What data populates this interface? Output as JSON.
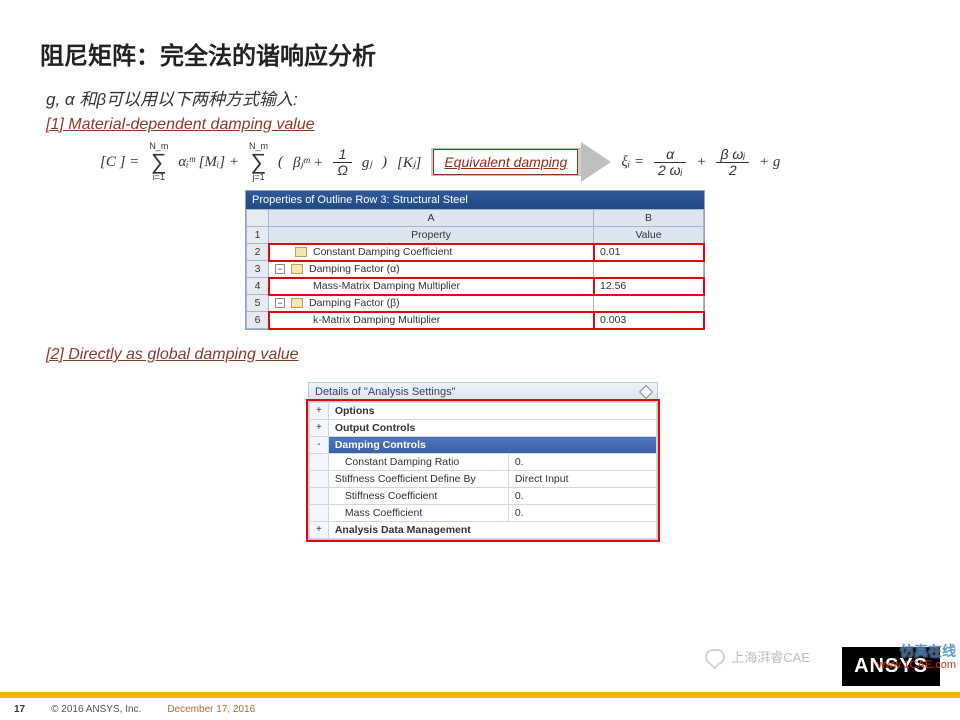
{
  "title": "阻尼矩阵：完全法的谐响应分析",
  "subtitle": "g, α 和β可以用以下两种方式输入:",
  "section1_label": "[1] Material-dependent damping value",
  "section2_label": "[2] Directly as global damping value",
  "equiv_label": "Equivalent damping",
  "formula": {
    "lhs": "[C ] =",
    "sum1_top": "N_m",
    "sum1_bot": "i=1",
    "term1": "αᵢᵐ [Mᵢ] +",
    "sum2_top": "N_m",
    "sum2_bot": "j=1",
    "paren_beta": "βⱼᵐ +",
    "frac_one": "1",
    "frac_omega": "Ω",
    "g_j": "gⱼ",
    "k_j": "[Kⱼ]",
    "xi": "ξᵢ =",
    "f1n": "α",
    "f1d": "2 ωᵢ",
    "f2n": "β ωᵢ",
    "f2d": "2",
    "plus_g": "+ g"
  },
  "tbl1": {
    "title": "Properties of Outline Row 3: Structural Steel",
    "col_a": "A",
    "col_b": "B",
    "head_a": "Property",
    "head_b": "Value",
    "rows": [
      {
        "n": "2",
        "name": "Constant Damping Coefficient",
        "value": "0.01",
        "icon": "chart"
      },
      {
        "n": "3",
        "name": "Damping Factor (α)",
        "value": "",
        "icon": "toggle"
      },
      {
        "n": "4",
        "name": "Mass-Matrix Damping Multiplier",
        "value": "12.56"
      },
      {
        "n": "5",
        "name": "Damping Factor (β)",
        "value": "",
        "icon": "toggle"
      },
      {
        "n": "6",
        "name": "k-Matrix Damping Multiplier",
        "value": "0.003"
      }
    ]
  },
  "details": {
    "title": "Details of \"Analysis Settings\"",
    "rows": [
      {
        "t": "+",
        "label": "Options"
      },
      {
        "t": "+",
        "label": "Output Controls"
      },
      {
        "t": "-",
        "label": "Damping Controls",
        "section": true
      },
      {
        "label": "Constant Damping Ratio",
        "value": "0."
      },
      {
        "label": "Stiffness Coefficient Define By",
        "value": "Direct Input"
      },
      {
        "label": "Stiffness Coefficient",
        "value": "0."
      },
      {
        "label": "Mass Coefficient",
        "value": "0."
      },
      {
        "t": "+",
        "label": "Analysis Data Management"
      }
    ]
  },
  "footer": {
    "page": "17",
    "copyright": "© 2016 ANSYS, Inc.",
    "date": "December 17, 2016"
  },
  "watermark": {
    "chat": "上海湃睿CAE",
    "zh": "仿真在线",
    "url": "www.1CAE.com"
  },
  "logo": "ANSYS"
}
